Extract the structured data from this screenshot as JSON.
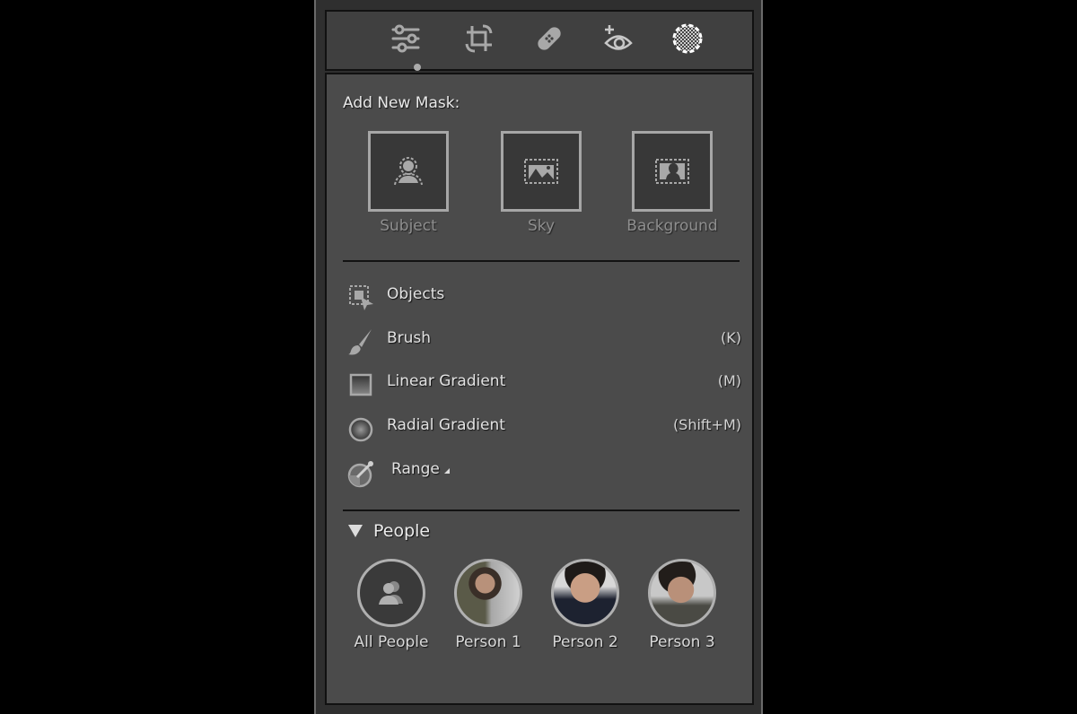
{
  "toolbar": {
    "tools": [
      {
        "name": "edit",
        "icon": "sliders-icon",
        "active": true
      },
      {
        "name": "crop",
        "icon": "crop-rotate-icon",
        "active": false
      },
      {
        "name": "heal",
        "icon": "bandage-icon",
        "active": false
      },
      {
        "name": "red-eye",
        "icon": "eye-plus-icon",
        "active": false
      },
      {
        "name": "masking",
        "icon": "mask-circle-icon",
        "active": false
      }
    ]
  },
  "mask": {
    "heading": "Add New Mask:",
    "quick": [
      {
        "label": "Subject",
        "icon": "subject-icon"
      },
      {
        "label": "Sky",
        "icon": "sky-icon"
      },
      {
        "label": "Background",
        "icon": "background-icon"
      }
    ],
    "tools": [
      {
        "label": "Objects",
        "shortcut": "",
        "icon": "objects-icon"
      },
      {
        "label": "Brush",
        "shortcut": "(K)",
        "icon": "brush-icon"
      },
      {
        "label": "Linear Gradient",
        "shortcut": "(M)",
        "icon": "linear-gradient-icon"
      },
      {
        "label": "Radial Gradient",
        "shortcut": "(Shift+M)",
        "icon": "radial-gradient-icon"
      },
      {
        "label": "Range",
        "shortcut": "",
        "icon": "range-icon"
      }
    ]
  },
  "people": {
    "heading": "People",
    "items": [
      {
        "label": "All People"
      },
      {
        "label": "Person 1"
      },
      {
        "label": "Person 2"
      },
      {
        "label": "Person 3"
      }
    ]
  }
}
